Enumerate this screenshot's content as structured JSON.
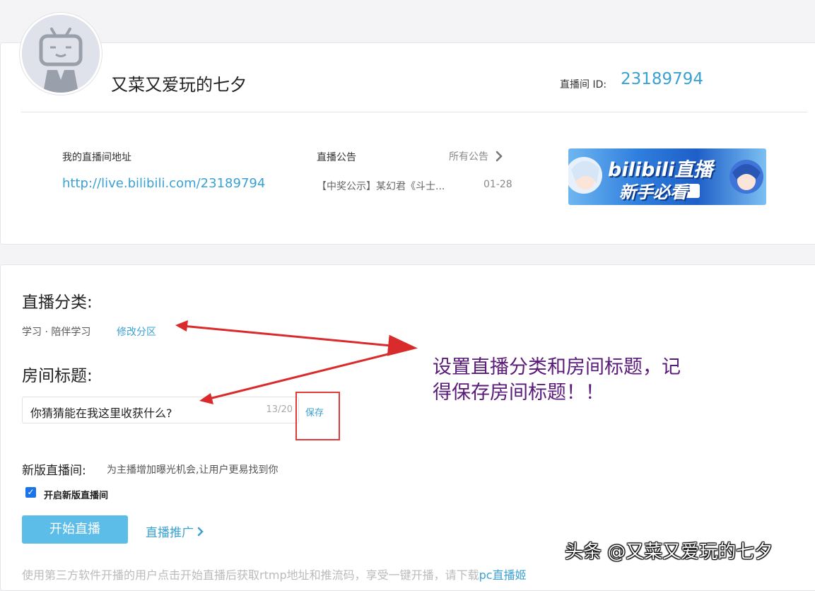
{
  "profile": {
    "username": "又菜又爱玩的七夕",
    "room_id_label": "直播间 ID:",
    "room_id": "23189794"
  },
  "address": {
    "label": "我的直播间地址",
    "url": "http://live.bilibili.com/23189794"
  },
  "notice": {
    "label": "直播公告",
    "all_label": "所有公告",
    "item_text": "【中奖公示】某幻君《斗士...",
    "item_date": "01-28"
  },
  "banner": {
    "title": "bilibili直播",
    "subtitle": "新手必看"
  },
  "category": {
    "heading": "直播分类:",
    "value": "学习 · 陪伴学习",
    "edit_label": "修改分区"
  },
  "room_title": {
    "heading": "房间标题:",
    "value": "你猜猜能在我这里收获什么?",
    "count": "13/20",
    "save_label": "保存"
  },
  "new_room": {
    "label": "新版直播间:",
    "description": "为主播增加曝光机会,让用户更易找到你",
    "checkbox_label": "开启新版直播间",
    "checked": true
  },
  "actions": {
    "start_label": "开始直播",
    "promo_label": "直播推广"
  },
  "bottom_note": {
    "text": "使用第三方软件开播的用户点击开始直播后获取rtmp地址和推流码，享受一键开播，请下载",
    "link": "pc直播姬"
  },
  "annotation": {
    "line1": "设置直播分类和房间标题，记",
    "line2": "得保存房间标题！！"
  },
  "watermark": "头条 @又菜又爱玩的七夕",
  "colors": {
    "accent": "#3aa1d3",
    "start_button": "#5cbde8",
    "annotation_arrow": "#d92b2b",
    "annotation_text": "#5a1a7a"
  }
}
